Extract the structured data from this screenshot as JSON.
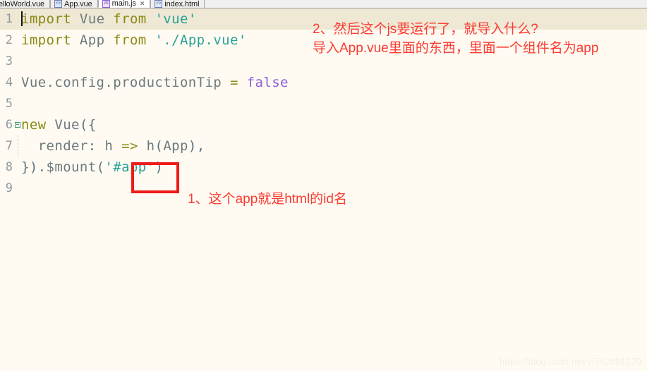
{
  "tabs": [
    {
      "label": "HelloWorld.vue",
      "icon": "vue-file-icon",
      "icon_glyph": "<>",
      "active": false,
      "closable": false
    },
    {
      "label": "App.vue",
      "icon": "vue-file-icon",
      "icon_glyph": "<>",
      "active": false,
      "closable": false
    },
    {
      "label": "main.js",
      "icon": "js-file-icon",
      "icon_glyph": "JS",
      "active": true,
      "closable": true,
      "close_glyph": "✕"
    },
    {
      "label": "index.html",
      "icon": "html-file-icon",
      "icon_glyph": "<>",
      "active": false,
      "closable": false
    }
  ],
  "editor": {
    "lines": [
      {
        "no": "1",
        "fold": false,
        "indent_guide": false,
        "current": true,
        "tokens": [
          {
            "t": "import",
            "c": "kw"
          },
          {
            "t": " ",
            "c": "pun"
          },
          {
            "t": "Vue",
            "c": "id"
          },
          {
            "t": " ",
            "c": "pun"
          },
          {
            "t": "from",
            "c": "kw"
          },
          {
            "t": " ",
            "c": "pun"
          },
          {
            "t": "'vue'",
            "c": "str"
          }
        ]
      },
      {
        "no": "2",
        "fold": false,
        "indent_guide": false,
        "current": false,
        "tokens": [
          {
            "t": "import",
            "c": "kw"
          },
          {
            "t": " ",
            "c": "pun"
          },
          {
            "t": "App",
            "c": "id"
          },
          {
            "t": " ",
            "c": "pun"
          },
          {
            "t": "from",
            "c": "kw"
          },
          {
            "t": " ",
            "c": "pun"
          },
          {
            "t": "'./App.vue'",
            "c": "str"
          }
        ]
      },
      {
        "no": "3",
        "fold": false,
        "indent_guide": false,
        "current": false,
        "tokens": []
      },
      {
        "no": "4",
        "fold": false,
        "indent_guide": false,
        "current": false,
        "tokens": [
          {
            "t": "Vue.config.productionTip",
            "c": "id"
          },
          {
            "t": " ",
            "c": "pun"
          },
          {
            "t": "=",
            "c": "kw"
          },
          {
            "t": " ",
            "c": "pun"
          },
          {
            "t": "false",
            "c": "lit"
          }
        ]
      },
      {
        "no": "5",
        "fold": false,
        "indent_guide": false,
        "current": false,
        "tokens": []
      },
      {
        "no": "6",
        "fold": true,
        "indent_guide": false,
        "current": false,
        "tokens": [
          {
            "t": "new",
            "c": "kw"
          },
          {
            "t": " ",
            "c": "pun"
          },
          {
            "t": "Vue",
            "c": "id"
          },
          {
            "t": "({",
            "c": "pun"
          }
        ]
      },
      {
        "no": "7",
        "fold": false,
        "indent_guide": true,
        "current": false,
        "tokens": [
          {
            "t": "  ",
            "c": "pun"
          },
          {
            "t": "render",
            "c": "id"
          },
          {
            "t": ": ",
            "c": "pun"
          },
          {
            "t": "h",
            "c": "id"
          },
          {
            "t": " ",
            "c": "pun"
          },
          {
            "t": "=>",
            "c": "kw"
          },
          {
            "t": " ",
            "c": "pun"
          },
          {
            "t": "h",
            "c": "id"
          },
          {
            "t": "(",
            "c": "pun"
          },
          {
            "t": "App",
            "c": "id"
          },
          {
            "t": "),",
            "c": "pun"
          }
        ]
      },
      {
        "no": "8",
        "fold": false,
        "indent_guide": false,
        "current": false,
        "tokens": [
          {
            "t": "}).",
            "c": "pun"
          },
          {
            "t": "$mount",
            "c": "id"
          },
          {
            "t": "(",
            "c": "pun"
          },
          {
            "t": "'",
            "c": "str"
          },
          {
            "t": "#app",
            "c": "str"
          },
          {
            "t": "'",
            "c": "str"
          },
          {
            "t": ")",
            "c": "pun"
          }
        ]
      },
      {
        "no": "9",
        "fold": false,
        "indent_guide": false,
        "current": false,
        "tokens": []
      }
    ]
  },
  "annotations": {
    "top": "2、然后这个js要运行了，就导入什么?\n导入App.vue里面的东西，里面一个组件名为app",
    "bottom": "1、这个app就是html的id名",
    "color": "#FB3A31",
    "highlight_box_color": "#EE1B18",
    "highlight_target": "#app"
  },
  "watermark": "https://blog.csdn.net/yi742891270",
  "theme": {
    "background": "#FFFBF2",
    "current_line": "#EEE8D5",
    "keyword": "#8A8A14",
    "string": "#2AA198",
    "literal": "#8C5FD8",
    "identifier": "#6C7A80",
    "line_number": "#8E9AA0"
  }
}
